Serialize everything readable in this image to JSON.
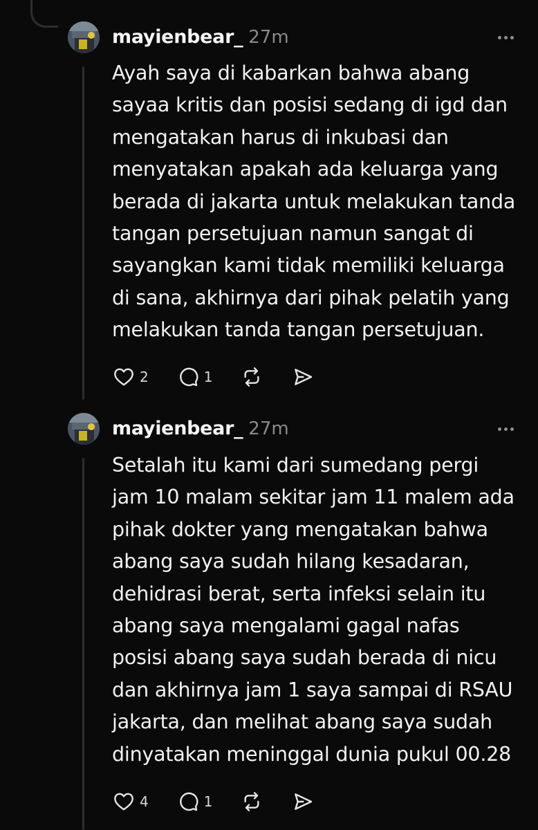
{
  "posts": [
    {
      "username": "mayienbear_",
      "time": "27m",
      "lines": [
        "Ayah saya di kabarkan bahwa abang",
        "sayaa kritis dan posisi sedang di igd dan",
        "mengatakan harus di inkubasi dan",
        "menyatakan apakah ada keluarga yang",
        "berada di jakarta untuk melakukan tanda",
        "tangan persetujuan namun sangat di",
        "sayangkan kami tidak memiliki keluarga",
        "di sana, akhirnya dari pihak pelatih yang",
        "melakukan tanda tangan persetujuan."
      ],
      "likes": "2",
      "replies": "1"
    },
    {
      "username": "mayienbear_",
      "time": "27m",
      "lines": [
        "Setalah itu kami dari sumedang pergi",
        "jam 10 malam sekitar jam 11 malem ada",
        "pihak dokter yang mengatakan bahwa",
        "abang saya sudah hilang kesadaran,",
        "dehidrasi berat, serta infeksi selain itu",
        "abang saya mengalami gagal nafas",
        "posisi abang saya sudah berada di nicu",
        "dan akhirnya jam 1 saya sampai di RSAU",
        "jakarta, dan melihat abang saya sudah",
        "dinyatakan meninggal dunia pukul 00.28"
      ],
      "likes": "4",
      "replies": "1"
    }
  ],
  "icons": {
    "like": "heart-icon",
    "reply": "comment-icon",
    "repost": "repost-icon",
    "share": "send-icon",
    "more": "more-dots-icon"
  },
  "colors": {
    "background": "#0a0a0a",
    "text": "#f2f2f2",
    "muted": "#8a8a8a",
    "thread_line": "#2e2e2e"
  }
}
